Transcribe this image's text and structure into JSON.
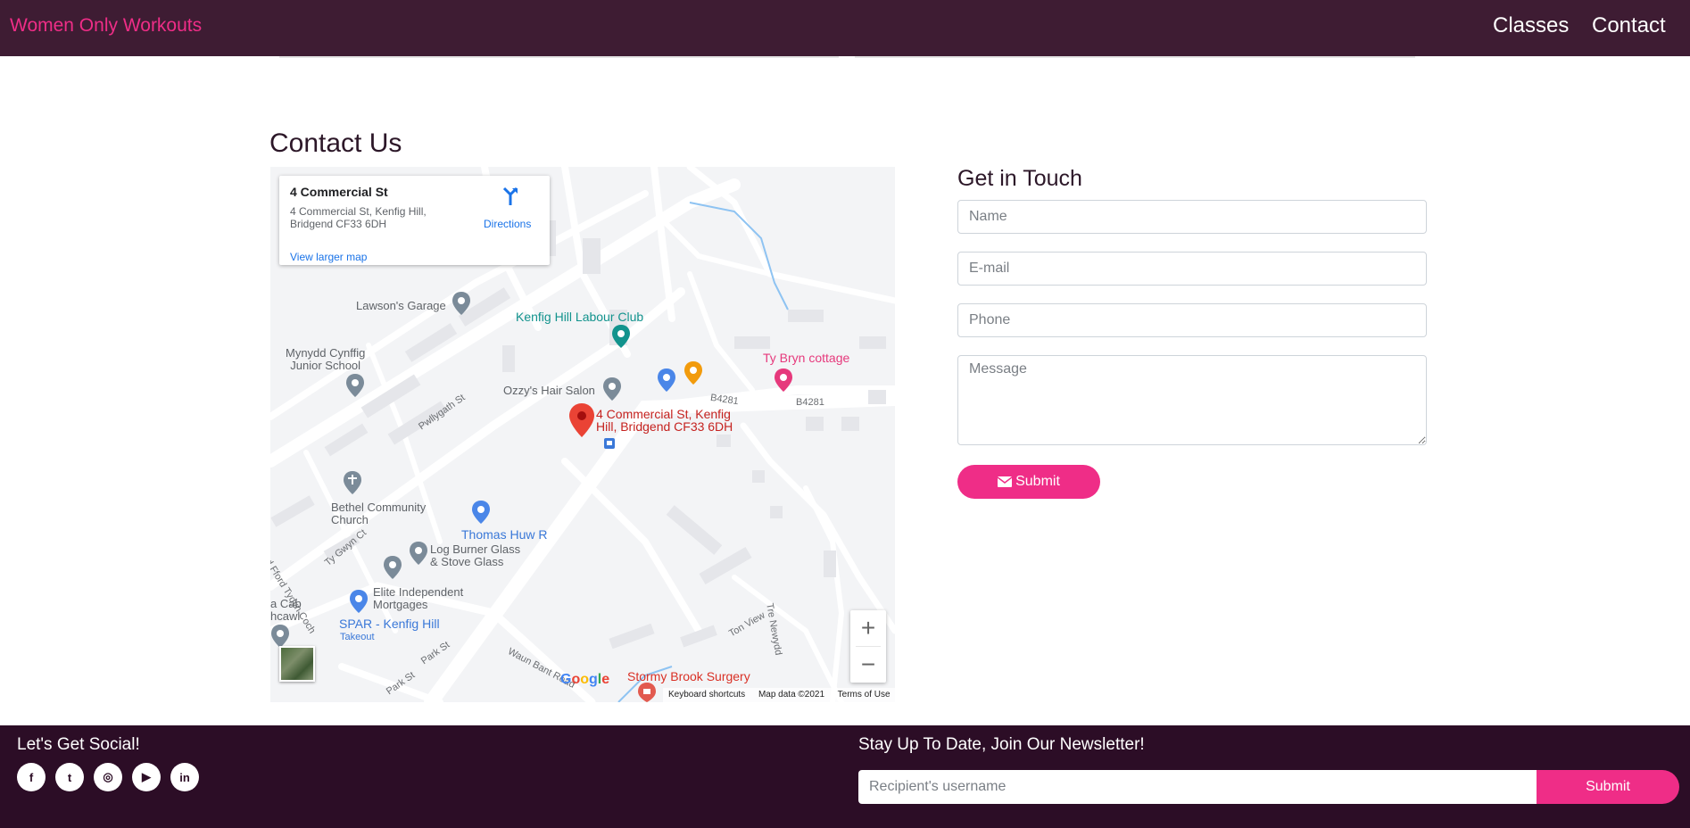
{
  "nav": {
    "brand": "Women Only Workouts",
    "links": [
      "Classes",
      "Contact"
    ]
  },
  "contact": {
    "title": "Contact Us"
  },
  "map": {
    "card": {
      "title": "4 Commercial St",
      "address": "4 Commercial St, Kenfig Hill, Bridgend CF33 6DH",
      "directions": "Directions",
      "larger_map": "View larger map"
    },
    "places": {
      "lawsons": "Lawson's Garage",
      "labour_club": "Kenfig Hill Labour Club",
      "school": "Mynydd Cynffig\nJunior School",
      "ty_bryn": "Ty Bryn cottage",
      "ozzys": "Ozzy's Hair Salon",
      "b4281_a": "B4281",
      "b4281_b": "B4281",
      "marker": "4 Commercial St, Kenfig\nHill, Bridgend CF33 6DH",
      "pwllygath": "Pwllygath St",
      "bethel": "Bethel Community\nChurch",
      "thomas": "Thomas Huw R",
      "log_burner": "Log Burner Glass\n& Stove Glass",
      "ty_gwyn": "Ty Gwyn Ct",
      "road_fford": "Road Fford Tydyn Coch",
      "elite": "Elite Independent\nMortgages",
      "cab": "a Cab\nhcawl",
      "spar": "SPAR - Kenfig Hill",
      "takeout": "Takeout",
      "park": "Park St",
      "park2": "Park St",
      "waun": "Waun Bant Road",
      "ton_view": "Ton View",
      "tre_newydd": "Tre Newydd",
      "stormy": "Stormy Brook Surgery"
    },
    "google": "Google",
    "attribution": {
      "shortcuts": "Keyboard shortcuts",
      "data": "Map data ©2021",
      "terms": "Terms of Use"
    },
    "zoom_in": "+",
    "zoom_out": "−"
  },
  "form": {
    "title": "Get in Touch",
    "name_placeholder": "Name",
    "email_placeholder": "E-mail",
    "phone_placeholder": "Phone",
    "message_placeholder": "Message",
    "submit": "Submit"
  },
  "footer": {
    "social_title": "Let's Get Social!",
    "socials": [
      {
        "name": "facebook-icon",
        "glyph": "f"
      },
      {
        "name": "twitter-icon",
        "glyph": "t"
      },
      {
        "name": "instagram-icon",
        "glyph": "◎"
      },
      {
        "name": "youtube-icon",
        "glyph": "▶"
      },
      {
        "name": "linkedin-icon",
        "glyph": "in"
      }
    ],
    "newsletter_title": "Stay Up To Date, Join Our Newsletter!",
    "newsletter_placeholder": "Recipient's username",
    "newsletter_submit": "Submit"
  },
  "colors": {
    "nav_bg": "#3e1c33",
    "brand_pink": "#ef2d87",
    "footer_bg": "#2c0d26"
  }
}
